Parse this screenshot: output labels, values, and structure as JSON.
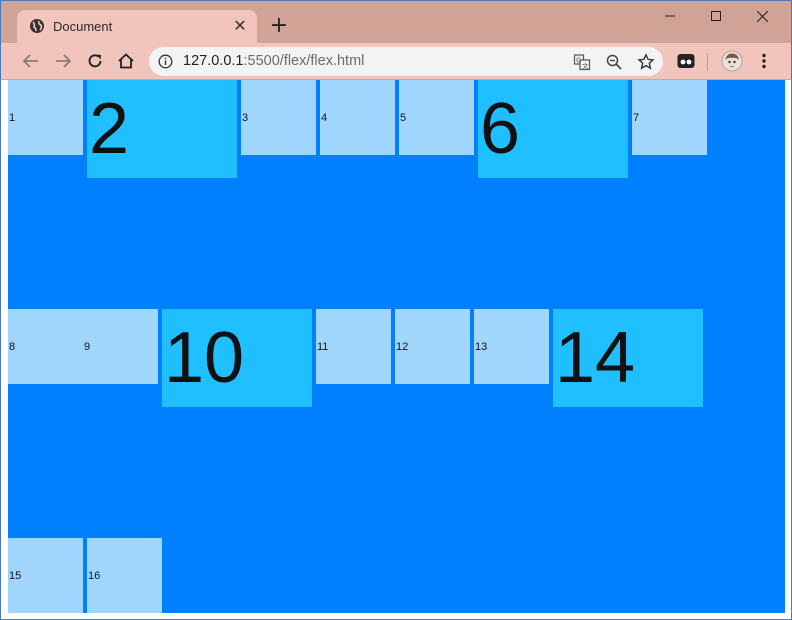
{
  "browser": {
    "tab_title": "Document",
    "tab_close_glyph": "✕",
    "new_tab_glyph": "+",
    "url_host": "127.0.0.1",
    "url_rest": ":5500/flex/flex.html",
    "icons": {
      "favicon": "globe-icon",
      "back": "back-arrow-icon",
      "forward": "forward-arrow-icon",
      "reload": "reload-icon",
      "home": "home-icon",
      "info": "info-icon",
      "translate": "translate-icon",
      "zoom": "zoom-out-icon",
      "bookmark": "star-icon",
      "extension": "extension-icon",
      "profile": "avatar",
      "menu": "kebab-menu-icon"
    },
    "colors": {
      "titlebar": "#d1a397",
      "tab": "#f1c5bb",
      "toolbar": "#f1c5bb",
      "omnibox": "#f1f3f4"
    }
  },
  "page": {
    "container_color": "#007fff",
    "item_color": "#a1d6fc",
    "big_item_color": "#20bfff",
    "items": [
      {
        "label": "1",
        "big": false
      },
      {
        "label": "2",
        "big": true
      },
      {
        "label": "3",
        "big": false
      },
      {
        "label": "4",
        "big": false
      },
      {
        "label": "5",
        "big": false
      },
      {
        "label": "6",
        "big": true
      },
      {
        "label": "7",
        "big": false
      },
      {
        "label": "8",
        "big": false
      },
      {
        "label": "9",
        "big": false
      },
      {
        "label": "10",
        "big": true
      },
      {
        "label": "11",
        "big": false
      },
      {
        "label": "12",
        "big": false
      },
      {
        "label": "13",
        "big": false
      },
      {
        "label": "14",
        "big": true
      },
      {
        "label": "15",
        "big": false
      },
      {
        "label": "16",
        "big": false
      }
    ]
  }
}
